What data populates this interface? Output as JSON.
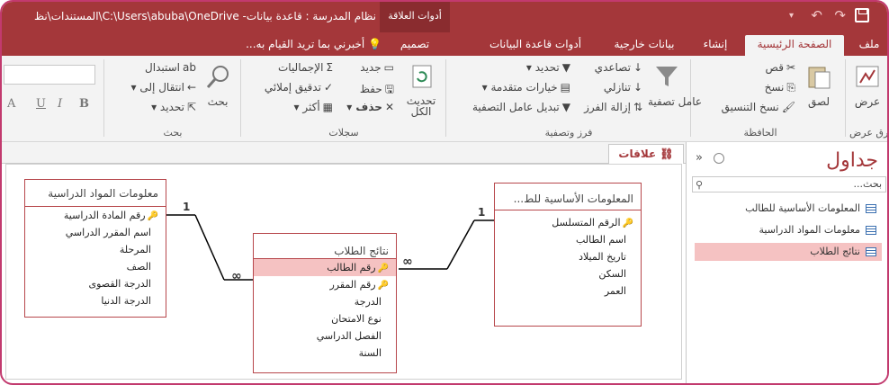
{
  "titlebar": {
    "context_label": "أدوات العلاقة",
    "title": "نظام المدرسة : قاعدة بيانات- C:\\Users\\abuba\\OneDrive\\المستندات\\نظ"
  },
  "tabs": {
    "file": "ملف",
    "home": "الصفحة الرئيسية",
    "create": "إنشاء",
    "external": "بيانات خارجية",
    "db_tools": "أدوات قاعدة البيانات",
    "design": "تصميم",
    "tellme": "أخبرني بما تريد القيام به..."
  },
  "ribbon": {
    "views": {
      "view": "عرض",
      "group": "طرق عرض"
    },
    "clipboard": {
      "paste": "لصق",
      "cut": "قص",
      "copy": "نسخ",
      "format_painter": "نسخ التنسيق",
      "group": "الحافظة"
    },
    "sort_filter": {
      "filter": "عامل تصفية",
      "ascending": "تصاعدي",
      "descending": "تنازلي",
      "remove_sort": "إزالة الفرز",
      "selection": "تحديد",
      "advanced": "خيارات متقدمة",
      "toggle_filter": "تبديل عامل التصفية",
      "group": "فرز وتصفية"
    },
    "records": {
      "refresh": "تحديث الكل",
      "new": "جديد",
      "save": "حفظ",
      "delete": "حذف",
      "totals": "الإجماليات",
      "spelling": "تدقيق إملائي",
      "more": "أكثر",
      "group": "سجلات"
    },
    "find": {
      "find": "بحث",
      "replace": "استبدال",
      "goto": "انتقال إلى",
      "select": "تحديد",
      "group": "بحث"
    },
    "text_format": {
      "bold": "B",
      "italic": "I",
      "underline": "U",
      "A": "A"
    }
  },
  "document": {
    "tab": "علاقات"
  },
  "tables": [
    {
      "title": "معلومات المواد الدراسية",
      "fields": [
        {
          "name": "رقم المادة الدراسية",
          "key": true
        },
        {
          "name": "اسم المقرر الدراسي",
          "key": false
        },
        {
          "name": "المرحلة",
          "key": false
        },
        {
          "name": "الصف",
          "key": false
        },
        {
          "name": "الدرجة القصوى",
          "key": false
        },
        {
          "name": "الدرجة الدنيا",
          "key": false
        }
      ]
    },
    {
      "title": "نتائج الطلاب",
      "fields": [
        {
          "name": "رقم الطالب",
          "key": true
        },
        {
          "name": "رقم المقرر",
          "key": true
        },
        {
          "name": "الدرجة",
          "key": false
        },
        {
          "name": "نوع الامتحان",
          "key": false
        },
        {
          "name": "الفصل الدراسي",
          "key": false
        },
        {
          "name": "السنة",
          "key": false
        }
      ]
    },
    {
      "title": "المعلومات الأساسية للط...",
      "fields": [
        {
          "name": "الرقم المتسلسل",
          "key": true
        },
        {
          "name": "اسم الطالب",
          "key": false
        },
        {
          "name": "تاريخ الميلاد",
          "key": false
        },
        {
          "name": "السكن",
          "key": false
        },
        {
          "name": "العمر",
          "key": false
        }
      ]
    }
  ],
  "relationship_labels": {
    "one": "1",
    "many": "∞"
  },
  "nav": {
    "title": "جداول",
    "search_placeholder": "بحث...",
    "items": [
      "المعلومات الأساسية للطالب",
      "معلومات المواد الدراسية",
      "نتائج الطلاب"
    ]
  },
  "colors": {
    "accent": "#a4373a",
    "selection": "#f5c2c2"
  }
}
